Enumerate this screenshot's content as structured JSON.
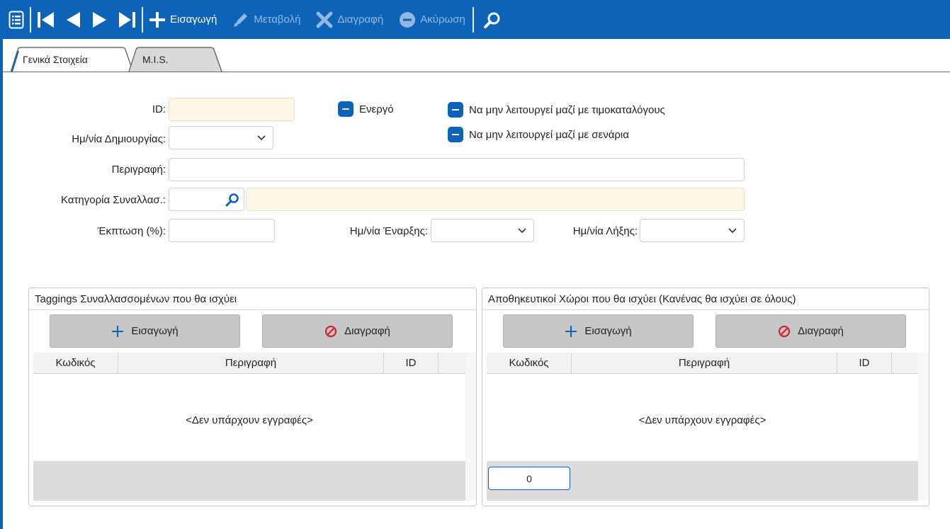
{
  "toolbar": {
    "insert_label": "Εισαγωγή",
    "edit_label": "Μεταβολή",
    "delete_label": "Διαγραφή",
    "cancel_label": "Ακύρωση"
  },
  "tabs": [
    {
      "label": "Γενικά Στοιχεία"
    },
    {
      "label": "M.I.S."
    }
  ],
  "form": {
    "id_label": "ID:",
    "id_value": "",
    "created_label": "Ημ/νία Δημιουργίας:",
    "created_value": "",
    "description_label": "Περιγραφή:",
    "description_value": "",
    "category_label": "Κατηγορία Συναλλασ.:",
    "category_code": "",
    "category_name": "",
    "discount_label": "Έκπτωση (%):",
    "discount_value": "",
    "start_label": "Ημ/νία Έναρξης:",
    "start_value": "",
    "end_label": "Ημ/νία Λήξης:",
    "end_value": "",
    "active_label": "Ενεργό",
    "no_pricelists_label": "Να μην λειτουργεί μαζί με τιμοκαταλόγους",
    "no_scenarios_label": "Να μην λειτουργεί μαζί με σενάρια"
  },
  "panels": {
    "tags": {
      "title": "Taggings Συναλλασσομένων που θα ισχύει",
      "insert_label": "Εισαγωγή",
      "delete_label": "Διαγραφή",
      "columns": [
        "Κωδικός",
        "Περιγραφή",
        "ID"
      ],
      "empty_text": "<Δεν υπάρχουν εγγραφές>"
    },
    "warehouses": {
      "title": "Αποθηκευτικοί Χώροι που θα ισχύει (Κανένας θα ισχύει σε όλους)",
      "insert_label": "Εισαγωγή",
      "delete_label": "Διαγραφή",
      "columns": [
        "Κωδικός",
        "Περιγραφή",
        "ID"
      ],
      "empty_text": "<Δεν υπάρχουν εγγραφές>",
      "count": "0"
    }
  },
  "colors": {
    "accent": "#0d63b8",
    "readonly_field": "#fff8e6",
    "delete_red": "#d2232a"
  },
  "icons": [
    "list-icon",
    "first-record-icon",
    "previous-record-icon",
    "next-record-icon",
    "last-record-icon",
    "plus-icon",
    "pencil-icon",
    "x-icon",
    "minus-circle-icon",
    "search-icon",
    "chevron-down-icon",
    "no-entry-icon"
  ]
}
